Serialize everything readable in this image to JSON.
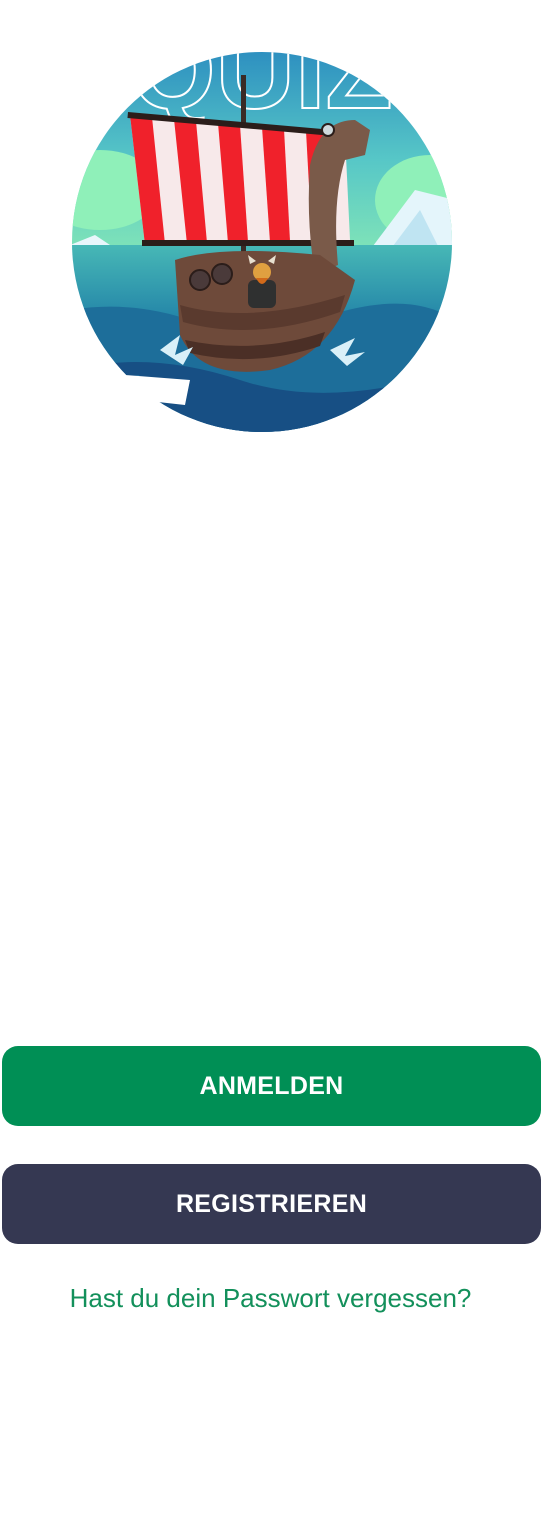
{
  "hero": {
    "logo_lettering": "QUIZ",
    "sail_color": "#f0212b",
    "sea_color": "#1f8ca3",
    "sky_color": "#3aa2c8"
  },
  "actions": {
    "login_label": "ANMELDEN",
    "register_label": "REGISTRIEREN",
    "forgot_password_label": "Hast du dein Passwort vergessen?"
  },
  "colors": {
    "primary": "#008f55",
    "secondary": "#353852",
    "link": "#13905b",
    "background": "#ffffff"
  }
}
